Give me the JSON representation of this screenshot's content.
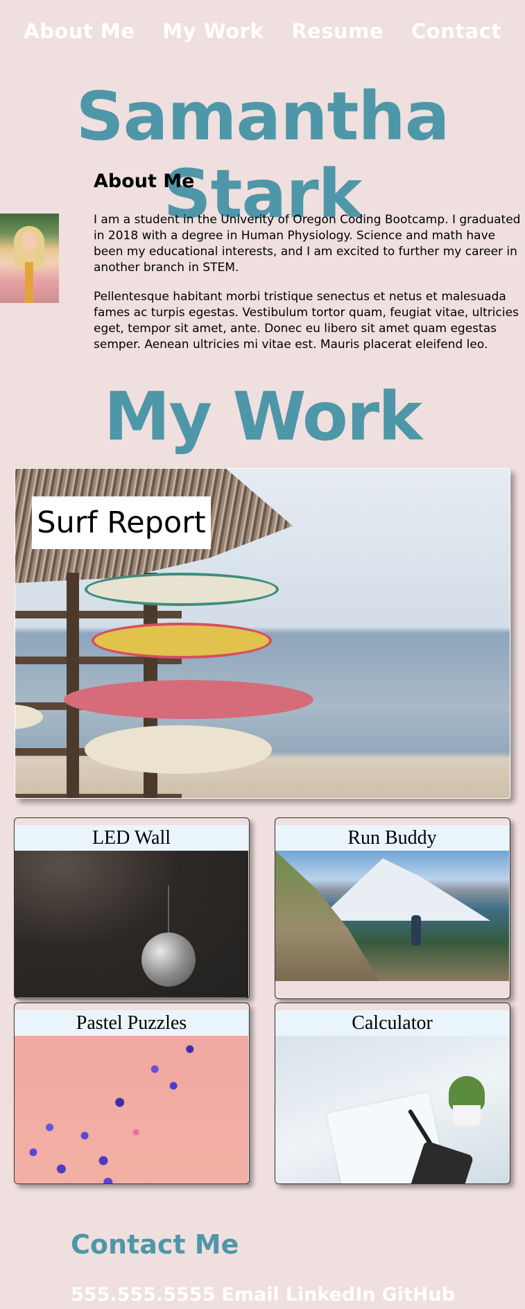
{
  "nav": {
    "items": [
      "About Me",
      "My Work",
      "Resume",
      "Contact"
    ]
  },
  "header": {
    "name": "Samantha Stark"
  },
  "about": {
    "heading": "About Me",
    "paragraph1": "I am a student in the Univerity of Oregon Coding Bootcamp. I graduated in 2018 with a degree in Human Physiology. Science and math have been my educational interests, and I am excited to further my career in another branch in STEM.",
    "paragraph2": "Pellentesque habitant morbi tristique senectus et netus et malesuada fames ac turpis egestas. Vestibulum tortor quam, feugiat vitae, ultricies eget, tempor sit amet, ante. Donec eu libero sit amet quam egestas semper. Aenean ultricies mi vitae est. Mauris placerat eleifend leo."
  },
  "work": {
    "heading": "My Work",
    "featured": {
      "label": "Surf Report"
    },
    "projects": [
      "LED Wall",
      "Run Buddy",
      "Pastel Puzzles",
      "Calculator"
    ]
  },
  "contact": {
    "heading": "Contact Me",
    "links": [
      "555.555.5555",
      "Email",
      "LinkedIn",
      "GitHub"
    ]
  },
  "colors": {
    "background": "#efdfde",
    "accent": "#4e97a8",
    "card_title_bg": "#eaf5fb",
    "nav_text": "#ffffff"
  }
}
